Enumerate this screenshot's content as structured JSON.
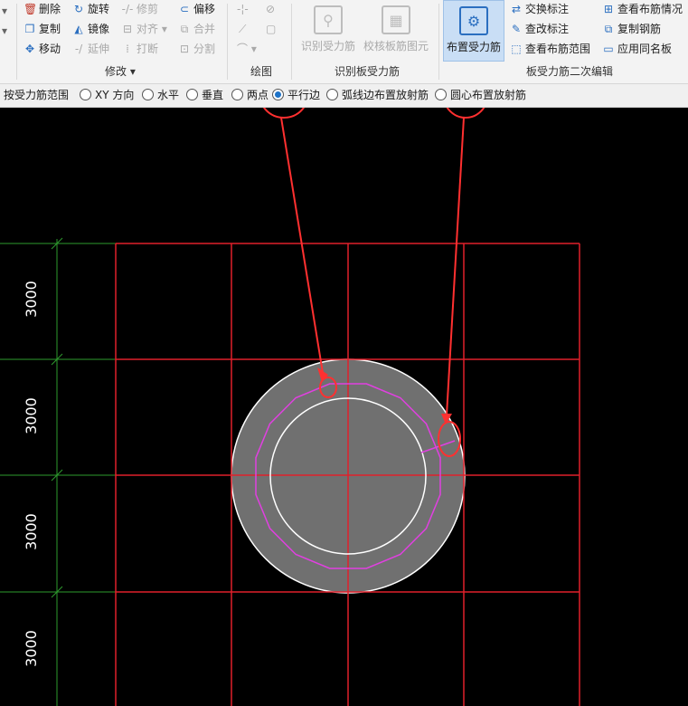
{
  "ribbon": {
    "modify": {
      "delete": "删除",
      "rotate": "旋转",
      "trim": "修剪",
      "offset": "偏移",
      "copy": "复制",
      "mirror": "镜像",
      "align": "对齐",
      "merge": "合并",
      "move": "移动",
      "extend": "延伸",
      "break": "打断",
      "split": "分割",
      "group_label": "修改"
    },
    "draw": {
      "group_label": "绘图"
    },
    "identify": {
      "identify_btn": "识别受力筋",
      "check_btn": "校核板筋图元",
      "group_label": "识别板受力筋"
    },
    "place": {
      "place_btn": "布置受力筋"
    },
    "secondary": {
      "swap_label": "交换标注",
      "edit_label": "查改标注",
      "view_range": "查看布筋范围",
      "view_layout": "查看布筋情况",
      "copy_rebar": "复制钢筋",
      "apply_same": "应用同名板",
      "group_label": "板受力筋二次编辑"
    }
  },
  "optionsbar": {
    "label": "按受力筋范围",
    "options": [
      "XY 方向",
      "水平",
      "垂直",
      "两点",
      "平行边",
      "弧线边布置放射筋",
      "圆心布置放射筋"
    ],
    "selected": "平行边"
  },
  "canvas": {
    "dimensions": [
      "3000",
      "3000",
      "3000",
      "3000"
    ]
  },
  "colors": {
    "grid_red": "#e0202b",
    "grid_green": "#2e9b2e",
    "slab_gray": "#707070",
    "rebar_magenta": "#e040e0",
    "annotation_red": "#ff3030"
  }
}
